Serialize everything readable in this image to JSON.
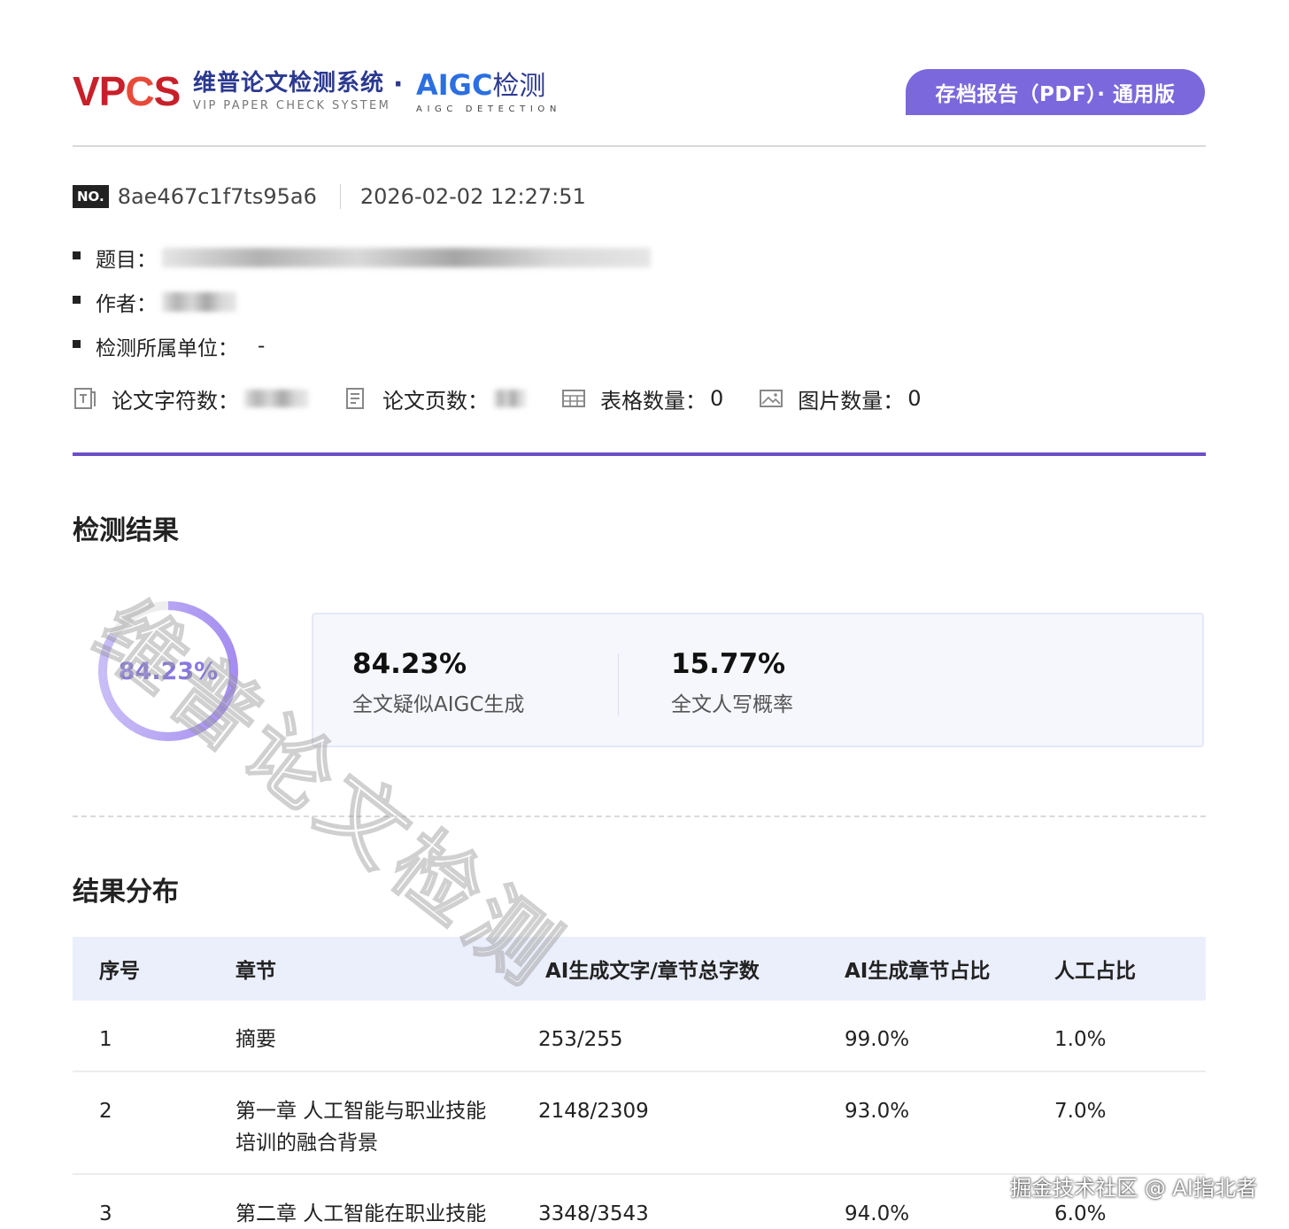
{
  "header": {
    "logo_vpcs": [
      "V",
      "P",
      "C",
      "S"
    ],
    "logo_cn": "维普论文检测系统",
    "logo_en": "VIP PAPER CHECK SYSTEM",
    "logo_dot": "·",
    "aigc_latin": "AIGC",
    "aigc_cn": "检测",
    "aigc_sub": "AIGC DETECTION",
    "report_button": "存档报告（PDF）· 通用版"
  },
  "meta": {
    "no_badge": "NO.",
    "report_no": "8ae467c1f7ts95a6",
    "date": "2026-02-02 12:27:51",
    "title_label": "题目：",
    "author_label": "作者：",
    "unit_label": "检测所属单位：",
    "unit_value": "-"
  },
  "stats": {
    "chars_label": "论文字符数：",
    "pages_label": "论文页数：",
    "tables_label": "表格数量：",
    "tables_value": "0",
    "images_label": "图片数量：",
    "images_value": "0"
  },
  "results": {
    "title": "检测结果",
    "ring_value": "84.23%",
    "ring_fraction": 0.8423,
    "ai_value": "84.23%",
    "ai_label": "全文疑似AIGC生成",
    "human_value": "15.77%",
    "human_label": "全文人写概率"
  },
  "distribution": {
    "title": "结果分布",
    "headers": [
      "序号",
      "章节",
      "AI生成文字/章节总字数",
      "AI生成章节占比",
      "人工占比"
    ],
    "rows": [
      {
        "no": "1",
        "chapter": "摘要",
        "chapter_line2": "",
        "ratio": "253/255",
        "ai": "99.0%",
        "human": "1.0%"
      },
      {
        "no": "2",
        "chapter": "第一章 人工智能与职业技能",
        "chapter_line2": "培训的融合背景",
        "ratio": "2148/2309",
        "ai": "93.0%",
        "human": "7.0%"
      },
      {
        "no": "3",
        "chapter": "第二章 人工智能在职业技能",
        "chapter_line2": "",
        "ratio": "3348/3543",
        "ai": "94.0%",
        "human": "6.0%"
      }
    ]
  },
  "watermark": "维普论文检测",
  "credit": "掘金技术社区 @ AI指北者",
  "colors": {
    "accent": "#7b68dd",
    "divider": "#6a4fc7",
    "brand_red": "#c8202a",
    "brand_blue": "#2b3990"
  }
}
